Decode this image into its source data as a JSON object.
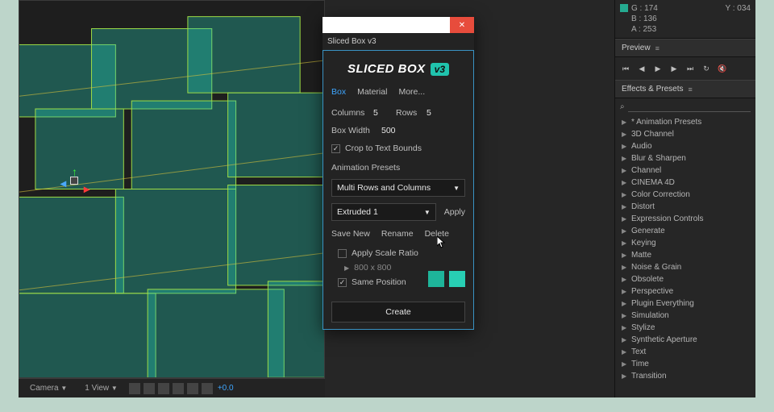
{
  "info": {
    "g": "G : 174",
    "y": "Y : 034",
    "b": "B : 136",
    "a": "A : 253"
  },
  "previewPanel": {
    "title": "Preview"
  },
  "effectsPanel": {
    "title": "Effects & Presets"
  },
  "effectsTree": [
    "* Animation Presets",
    "3D Channel",
    "Audio",
    "Blur & Sharpen",
    "Channel",
    "CINEMA 4D",
    "Color Correction",
    "Distort",
    "Expression Controls",
    "Generate",
    "Keying",
    "Matte",
    "Noise & Grain",
    "Obsolete",
    "Perspective",
    "Plugin Everything",
    "Simulation",
    "Stylize",
    "Synthetic Aperture",
    "Text",
    "Time",
    "Transition"
  ],
  "viewportToolbar": {
    "camera": "Camera",
    "views": "1 View",
    "zoom": "+0.0"
  },
  "dialog": {
    "tabTitle": "Sliced Box v3",
    "brand1": "SLICED BOX",
    "brand2": "v3",
    "tabs": {
      "box": "Box",
      "material": "Material",
      "more": "More..."
    },
    "columnsLabel": "Columns",
    "columnsVal": "5",
    "rowsLabel": "Rows",
    "rowsVal": "5",
    "boxWidthLabel": "Box Width",
    "boxWidthVal": "500",
    "cropLabel": "Crop to Text Bounds",
    "animPresetsLabel": "Animation Presets",
    "animPresetDrop": "Multi Rows and Columns",
    "extrudedDrop": "Extruded 1",
    "applyBtn": "Apply",
    "saveNew": "Save New",
    "rename": "Rename",
    "delete": "Delete",
    "applyScale": "Apply Scale Ratio",
    "eightHundred": "800 x 800",
    "samePos": "Same Position",
    "createBtn": "Create"
  }
}
